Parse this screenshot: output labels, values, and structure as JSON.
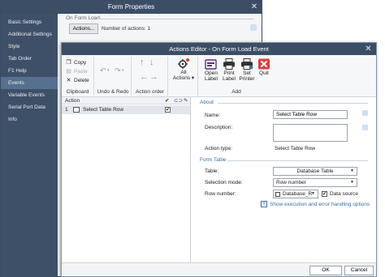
{
  "form_properties": {
    "title": "Form Properties",
    "sidebar": [
      {
        "label": "Basic Settings",
        "active": false
      },
      {
        "label": "Additional Settings",
        "active": false
      },
      {
        "label": "Style",
        "active": false
      },
      {
        "label": "Tab Order",
        "active": false
      },
      {
        "label": "F1 Help",
        "active": false
      },
      {
        "label": "Events",
        "active": true
      },
      {
        "label": "Variable Events",
        "active": false
      },
      {
        "label": "Serial Port Data",
        "active": false
      },
      {
        "label": "Info",
        "active": false
      }
    ],
    "section_label": "On Form Load",
    "actions_button": "Actions...",
    "actions_count": "Number of actions: 1"
  },
  "actions_editor": {
    "title": "Actions Editor - On Form Load Event",
    "ribbon": {
      "clipboard": {
        "copy": "Copy",
        "paste": "Paste",
        "delete": "Delete",
        "label": "Clipboard"
      },
      "undo_redo": {
        "label": "Undo & Redo"
      },
      "action_order": {
        "label": "Action order"
      },
      "all_actions": {
        "line1": "All",
        "line2": "Actions ▾"
      },
      "add": {
        "open_label": [
          "Open",
          "Label"
        ],
        "print_label": [
          "Print",
          "Label"
        ],
        "set_printer": [
          "Set",
          "Printer"
        ],
        "quit": [
          "Quit"
        ],
        "label": "Add"
      }
    },
    "action_list": {
      "header": "Action",
      "rows": [
        {
          "number": "1",
          "label": "Select Table Row",
          "checked": true
        }
      ]
    },
    "about": {
      "section": "About",
      "name_label": "Name:",
      "name_value": "Select Table Row",
      "description_label": "Description:",
      "description_value": "",
      "action_type_label": "Action type:",
      "action_type_value": "Select Table Row"
    },
    "form_table": {
      "section": "Form Table",
      "table_label": "Table:",
      "table_value": "Database Table",
      "selection_mode_label": "Selection mode:",
      "selection_mode_value": "Row number",
      "row_number_label": "Row number:",
      "row_number_value": "Database_R",
      "data_source_label": "Data source",
      "show_execution_link": "Show execution and error handling options"
    },
    "footer": {
      "ok": "OK",
      "cancel": "Cancel"
    }
  },
  "colors": {
    "titlebar": "#3c4e66",
    "sidebar_bg": "#3e5068",
    "sidebar_active": "#56708f",
    "section_blue": "#3b6ea8",
    "quit_red": "#d94141"
  }
}
